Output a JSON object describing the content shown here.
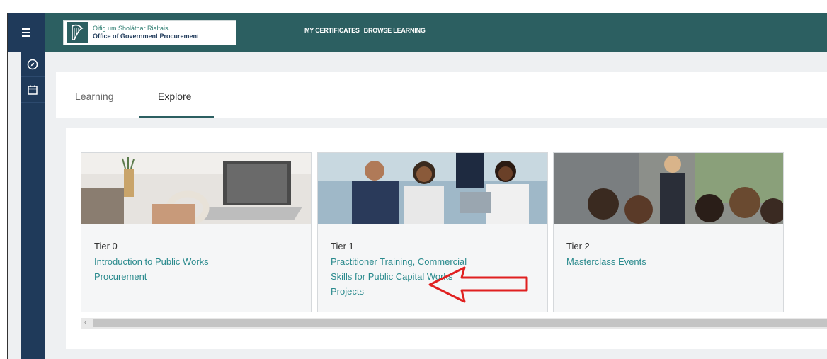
{
  "header": {
    "logo_line1": "Oifig um Sholáthar Rialtais",
    "logo_line2": "Office of Government Procurement",
    "nav": [
      "MY CERTIFICATES",
      "BROWSE LEARNING"
    ]
  },
  "sidebar": {
    "icons": [
      "compass-icon",
      "calendar-icon"
    ]
  },
  "tabs": [
    {
      "label": "Learning",
      "active": false
    },
    {
      "label": "Explore",
      "active": true
    }
  ],
  "cards": [
    {
      "tier": "Tier 0",
      "title": "Introduction to Public Works Procurement"
    },
    {
      "tier": "Tier 1",
      "title": "Practitioner Training, Commercial Skills for Public Capital Works Projects"
    },
    {
      "tier": "Tier 2",
      "title": "Masterclass Events"
    }
  ],
  "colors": {
    "header": "#2c5f61",
    "sidebar": "#1f3a5a",
    "link": "#2a8a8d",
    "arrow": "#e02020"
  }
}
